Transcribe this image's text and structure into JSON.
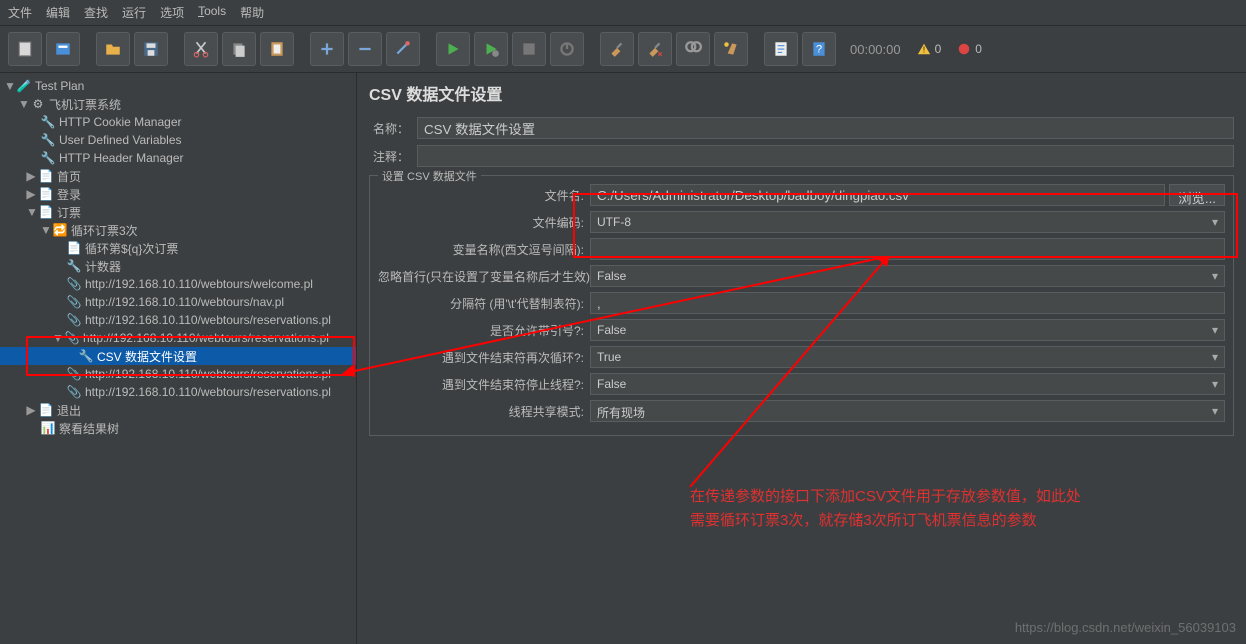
{
  "menu": {
    "items": [
      "文件",
      "编辑",
      "查找",
      "运行",
      "选项",
      "Tools",
      "帮助"
    ]
  },
  "toolbar": {
    "timer": "00:00:00",
    "warn_count": "0",
    "err_count": "0"
  },
  "tree": {
    "root": "Test Plan",
    "items": [
      "飞机订票系统",
      "HTTP Cookie Manager",
      "User Defined Variables",
      "HTTP Header Manager",
      "首页",
      "登录",
      "订票",
      "循环订票3次",
      "循环第${q}次订票",
      "计数器",
      "http://192.168.10.110/webtours/welcome.pl",
      "http://192.168.10.110/webtours/nav.pl",
      "http://192.168.10.110/webtours/reservations.pl",
      "http://192.168.10.110/webtours/reservations.pl",
      "CSV 数据文件设置",
      "http://192.168.10.110/webtours/reservations.pl",
      "http://192.168.10.110/webtours/reservations.pl",
      "退出",
      "察看结果树"
    ]
  },
  "panel": {
    "title": "CSV 数据文件设置",
    "name_label": "名称：",
    "name_value": "CSV 数据文件设置",
    "comment_label": "注释：",
    "comment_value": "",
    "fieldset_title": "设置 CSV 数据文件",
    "fields": {
      "filename_label": "文件名:",
      "filename_value": "C:/Users/Administrator/Desktop/badboy/dingpiao.csv",
      "browse": "浏览...",
      "encoding_label": "文件编码:",
      "encoding_value": "UTF-8",
      "varnames_label": "变量名称(西文逗号间隔):",
      "varnames_value": "",
      "ignore_label": "忽略首行(只在设置了变量名称后才生效):",
      "ignore_value": "False",
      "delimiter_label": "分隔符 (用'\\t'代替制表符):",
      "delimiter_value": ",",
      "quoted_label": "是否允许带引号?:",
      "quoted_value": "False",
      "recycle_label": "遇到文件结束符再次循环?:",
      "recycle_value": "True",
      "stop_label": "遇到文件结束符停止线程?:",
      "stop_value": "False",
      "sharing_label": "线程共享模式:",
      "sharing_value": "所有现场"
    }
  },
  "annotation": {
    "line1": "在传递参数的接口下添加CSV文件用于存放参数值，如此处",
    "line2": "需要循环订票3次，就存储3次所订飞机票信息的参数"
  },
  "watermark": "https://blog.csdn.net/weixin_56039103"
}
